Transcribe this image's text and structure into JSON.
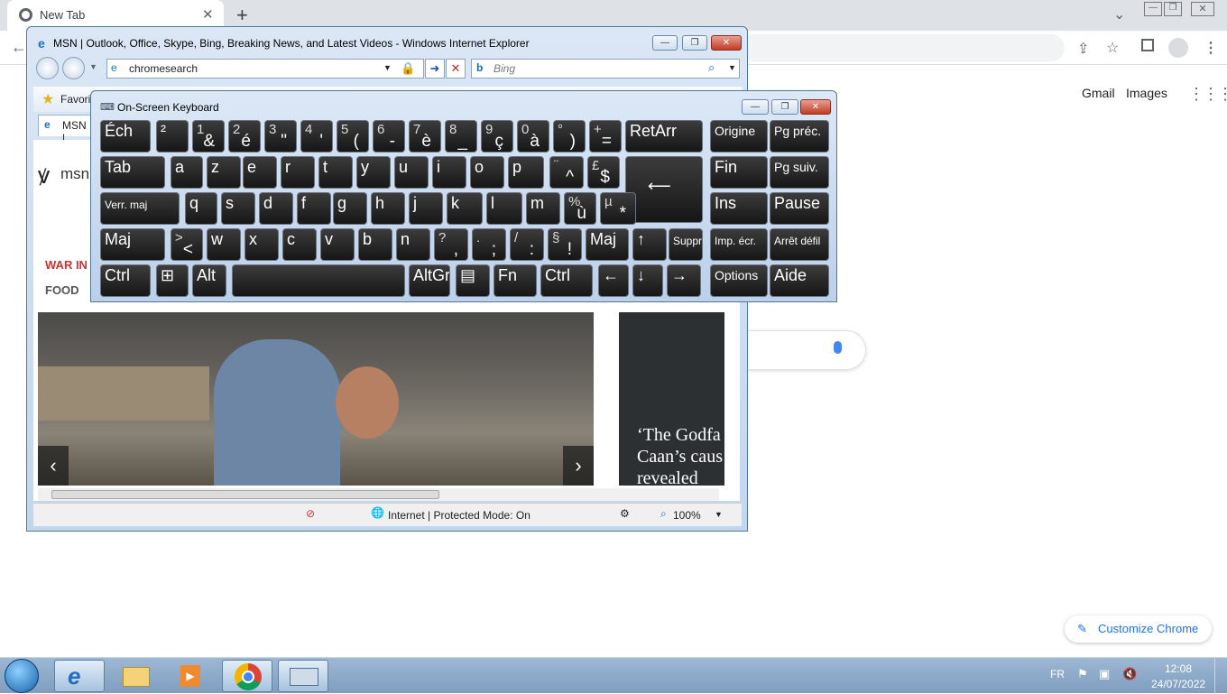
{
  "chrome": {
    "tab_title": "New Tab",
    "new_tab_symbol": "+",
    "links": [
      "Gmail",
      "Images"
    ],
    "customize_label": "Customize Chrome"
  },
  "ie": {
    "title": "MSN | Outlook, Office, Skype, Bing, Breaking News, and Latest Videos - Windows Internet Explorer",
    "address": "chromesearch",
    "search_placeholder": "Bing",
    "favorites_label": "Favorit",
    "tab_label": "MSN |",
    "msn_logo": "msn",
    "nav_war": "WAR IN",
    "nav_food": "FOOD",
    "card_headline": "‘The Godfa Caan’s caus revealed",
    "status_zone": "Internet | Protected Mode: On",
    "zoom": "100%"
  },
  "osk": {
    "title": "On-Screen Keyboard",
    "rows": [
      [
        {
          "m": "Éch"
        },
        {
          "m": "²"
        },
        {
          "s": "1",
          "b": "&"
        },
        {
          "s": "2",
          "b": "é"
        },
        {
          "s": "3",
          "b": "\""
        },
        {
          "s": "4",
          "b": "'"
        },
        {
          "s": "5",
          "b": "("
        },
        {
          "s": "6",
          "b": "-"
        },
        {
          "s": "7",
          "b": "è"
        },
        {
          "s": "8",
          "b": "_"
        },
        {
          "s": "9",
          "b": "ç"
        },
        {
          "s": "0",
          "b": "à"
        },
        {
          "s": "°",
          "b": ")"
        },
        {
          "s": "+",
          "b": "="
        },
        {
          "m": "RetArr"
        },
        {
          "m": "Origine"
        },
        {
          "m": "Pg préc."
        }
      ],
      [
        {
          "m": "Tab"
        },
        {
          "m": "a"
        },
        {
          "m": "z"
        },
        {
          "m": "e"
        },
        {
          "m": "r"
        },
        {
          "m": "t"
        },
        {
          "m": "y"
        },
        {
          "m": "u"
        },
        {
          "m": "i"
        },
        {
          "m": "o"
        },
        {
          "m": "p"
        },
        {
          "s": "¨",
          "b": "^"
        },
        {
          "s": "£",
          "b": "$"
        },
        {
          "m": "⟵"
        },
        {
          "m": "Fin"
        },
        {
          "m": "Pg suiv."
        }
      ],
      [
        {
          "m": "Verr. maj"
        },
        {
          "m": "q"
        },
        {
          "m": "s"
        },
        {
          "m": "d"
        },
        {
          "m": "f"
        },
        {
          "m": "g"
        },
        {
          "m": "h"
        },
        {
          "m": "j"
        },
        {
          "m": "k"
        },
        {
          "m": "l"
        },
        {
          "m": "m"
        },
        {
          "s": "%",
          "b": "ù"
        },
        {
          "s": "µ",
          "b": "*"
        },
        {
          "m": "Ins"
        },
        {
          "m": "Pause"
        }
      ],
      [
        {
          "m": "Maj"
        },
        {
          "s": ">",
          "b": "<"
        },
        {
          "m": "w"
        },
        {
          "m": "x"
        },
        {
          "m": "c"
        },
        {
          "m": "v"
        },
        {
          "m": "b"
        },
        {
          "m": "n"
        },
        {
          "s": "?",
          "b": ","
        },
        {
          "s": ".",
          "b": ";"
        },
        {
          "s": "/",
          "b": ":"
        },
        {
          "s": "§",
          "b": "!"
        },
        {
          "m": "Maj"
        },
        {
          "m": "↑"
        },
        {
          "m": "Suppr"
        },
        {
          "m": "Imp. écr."
        },
        {
          "m": "Arrêt défil"
        }
      ],
      [
        {
          "m": "Ctrl"
        },
        {
          "m": "⊞"
        },
        {
          "m": "Alt"
        },
        {
          "m": ""
        },
        {
          "m": "AltGr"
        },
        {
          "m": "▤"
        },
        {
          "m": "Fn"
        },
        {
          "m": "Ctrl"
        },
        {
          "m": "←"
        },
        {
          "m": "↓"
        },
        {
          "m": "→"
        },
        {
          "m": "Options"
        },
        {
          "m": "Aide"
        }
      ]
    ]
  },
  "taskbar": {
    "lang": "FR",
    "time": "12:08",
    "date": "24/07/2022"
  }
}
